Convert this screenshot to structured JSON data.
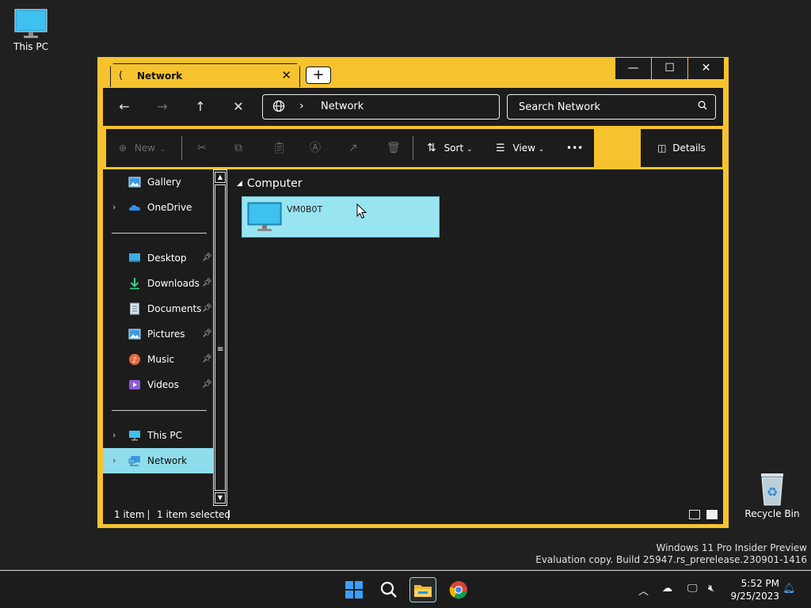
{
  "desktop": {
    "this_pc_label": "This PC",
    "recycle_bin_label": "Recycle Bin",
    "watermark_line1": "Windows 11 Pro Insider Preview",
    "watermark_line2": "Evaluation copy. Build 25947.rs_prerelease.230901-1416"
  },
  "window": {
    "tab_title": "Network",
    "tab_close": "✕",
    "new_tab": "+",
    "minimize": "—",
    "maximize": "☐",
    "close": "✕"
  },
  "navbar": {
    "back": "←",
    "forward": "→",
    "up": "↑",
    "stop": "✕",
    "address_separator": "›",
    "address": "Network",
    "search_placeholder": "Search Network"
  },
  "commandbar": {
    "new_label": "New",
    "sort_label": "Sort",
    "view_label": "View",
    "more": "•••",
    "details_label": "Details"
  },
  "sidebar": {
    "items": [
      {
        "label": "Gallery"
      },
      {
        "label": "OneDrive"
      },
      {
        "label": "Desktop"
      },
      {
        "label": "Downloads"
      },
      {
        "label": "Documents"
      },
      {
        "label": "Pictures"
      },
      {
        "label": "Music"
      },
      {
        "label": "Videos"
      },
      {
        "label": "This PC"
      },
      {
        "label": "Network"
      }
    ]
  },
  "content": {
    "group_header": "Computer",
    "item_label": "VM0B0T"
  },
  "status": {
    "item_count": "1 item",
    "selected": "1 item selected"
  },
  "taskbar": {
    "time": "5:52 PM",
    "date": "9/25/2023"
  },
  "colors": {
    "accent_border": "#f6c32f",
    "selection": "#8fdcec",
    "surface": "#1c1c1c"
  }
}
